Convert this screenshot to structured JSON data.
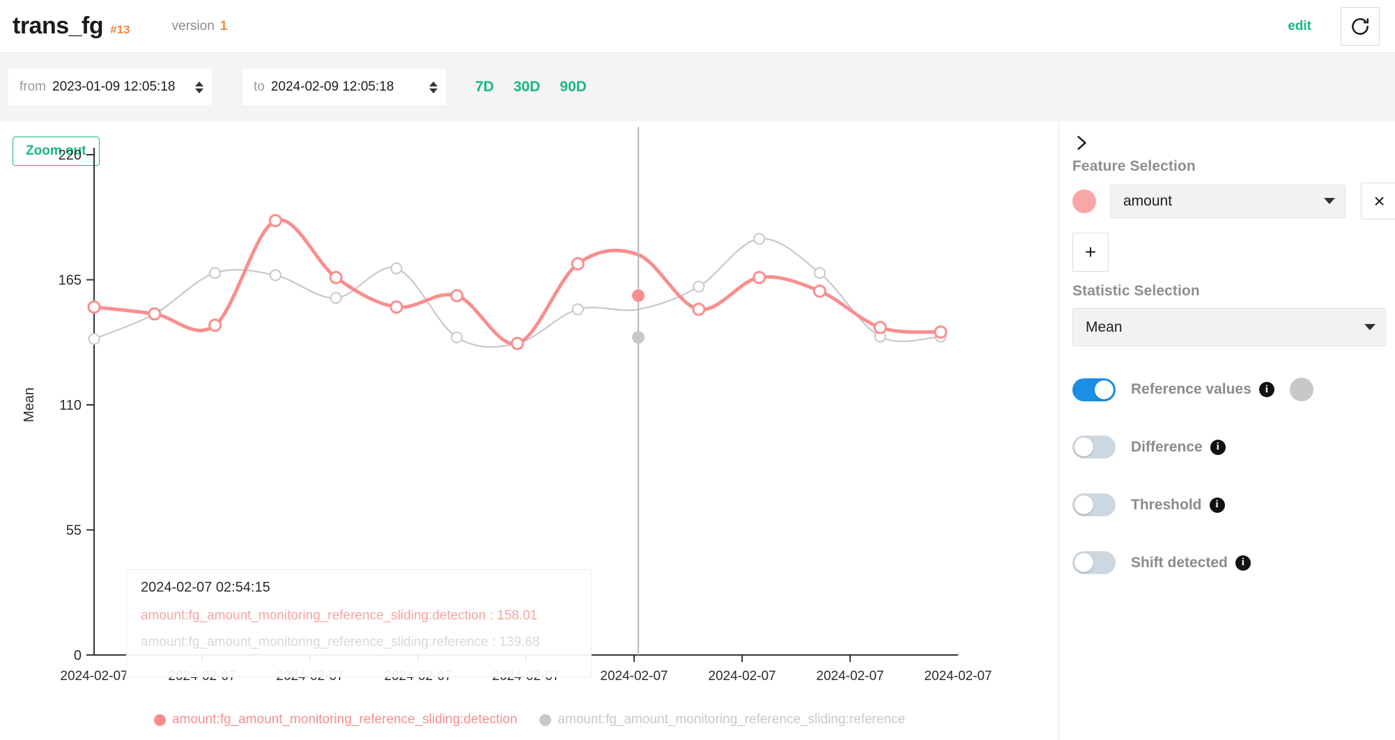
{
  "header": {
    "title": "trans_fg",
    "id_badge": "#13",
    "version_label": "version",
    "version_number": "1",
    "edit_label": "edit",
    "refresh_icon": "refresh-icon"
  },
  "toolbar": {
    "from_prefix": "from",
    "from_value": "2023-01-09 12:05:18",
    "to_prefix": "to",
    "to_value": "2024-02-09 12:05:18",
    "ranges": [
      {
        "label": "7D"
      },
      {
        "label": "30D"
      },
      {
        "label": "90D"
      }
    ]
  },
  "chart_panel": {
    "zoom_out_label": "Zoom out",
    "tooltip": {
      "timestamp": "2024-02-07 02:54:15",
      "detection_row": "amount:fg_amount_monitoring_reference_sliding:detection : 158.01",
      "reference_row": "amount:fg_amount_monitoring_reference_sliding:reference : 139.68"
    }
  },
  "side_panel": {
    "collapse_icon": "chevron-right-icon",
    "feature_selection_label": "Feature Selection",
    "feature_value": "amount",
    "feature_color": "#fba6a6",
    "remove_label": "×",
    "add_label": "+",
    "statistic_selection_label": "Statistic Selection",
    "statistic_value": "Mean",
    "toggles": [
      {
        "label": "Reference values",
        "state": "on",
        "has_swatch": true,
        "swatch_color": "#c8c8c8"
      },
      {
        "label": "Difference",
        "state": "off",
        "has_swatch": false,
        "swatch_color": ""
      },
      {
        "label": "Threshold",
        "state": "off",
        "has_swatch": false,
        "swatch_color": ""
      },
      {
        "label": "Shift detected",
        "state": "off",
        "has_swatch": false,
        "swatch_color": ""
      }
    ]
  },
  "chart_data": {
    "type": "line",
    "title": "",
    "xlabel": "",
    "ylabel": "Mean",
    "ylim": [
      0,
      220
    ],
    "yticks": [
      0,
      55,
      110,
      165,
      220
    ],
    "xticks": [
      "2024-02-07",
      "2024-02-07",
      "2024-02-07",
      "2024-02-07",
      "2024-02-07",
      "2024-02-07",
      "2024-02-07",
      "2024-02-07",
      "2024-02-07"
    ],
    "grid": false,
    "legend_position": "bottom",
    "colors": {
      "detection": "#f98e8e",
      "reference": "#c8c8c8"
    },
    "cursor": {
      "x_index": 9,
      "timestamp": "2024-02-07 02:54:15",
      "detection_value": 158.01,
      "reference_value": 139.68
    },
    "series": [
      {
        "name": "amount:fg_amount_monitoring_reference_sliding:detection",
        "color": "#f98e8e",
        "values": [
          153,
          150,
          145,
          191,
          166,
          153,
          158.01,
          137,
          172,
          176,
          152,
          166,
          160,
          144,
          142
        ]
      },
      {
        "name": "amount:fg_amount_monitoring_reference_sliding:reference",
        "color": "#c8c8c8",
        "values": [
          139,
          150,
          168,
          167,
          157,
          170,
          139.68,
          137,
          152,
          152,
          162,
          183,
          168,
          140,
          140
        ]
      }
    ],
    "legend": [
      {
        "label": "amount:fg_amount_monitoring_reference_sliding:detection",
        "color": "#f98e8e"
      },
      {
        "label": "amount:fg_amount_monitoring_reference_sliding:reference",
        "color": "#c8c8c8"
      }
    ]
  }
}
